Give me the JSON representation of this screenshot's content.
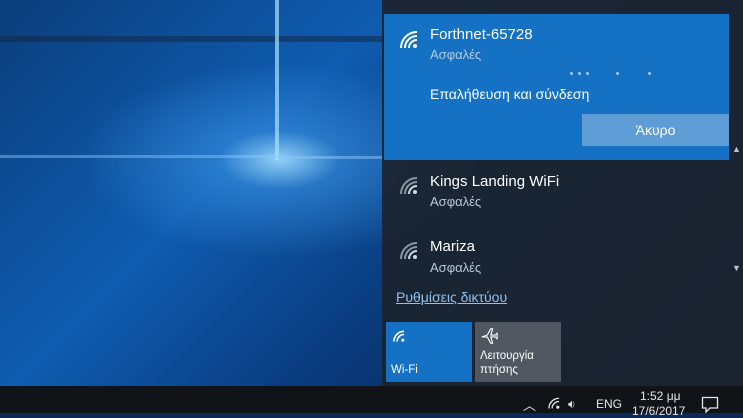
{
  "networks": {
    "active": {
      "name": "Forthnet-65728",
      "status": "Ασφαλές",
      "connecting_text": "Επαλήθευση και σύνδεση",
      "cancel_label": "Άκυρο"
    },
    "others": [
      {
        "name": "Kings Landing WiFi",
        "status": "Ασφαλές"
      },
      {
        "name": "Mariza",
        "status": "Ασφαλές"
      }
    ]
  },
  "settings_link": "Ρυθμίσεις δικτύου",
  "quick_actions": {
    "wifi_label": "Wi-Fi",
    "airplane_label_line1": "Λειτουργία",
    "airplane_label_line2": "πτήσης"
  },
  "taskbar": {
    "language": "ENG",
    "time": "1:52 μμ",
    "date": "17/6/2017"
  },
  "colors": {
    "accent": "#1471c4",
    "flyout_bg": "#1c242e",
    "link": "#8fc0ee"
  },
  "icons": [
    "wifi-icon",
    "airplane-icon",
    "chevron-up-icon",
    "volume-icon",
    "notification-icon"
  ]
}
